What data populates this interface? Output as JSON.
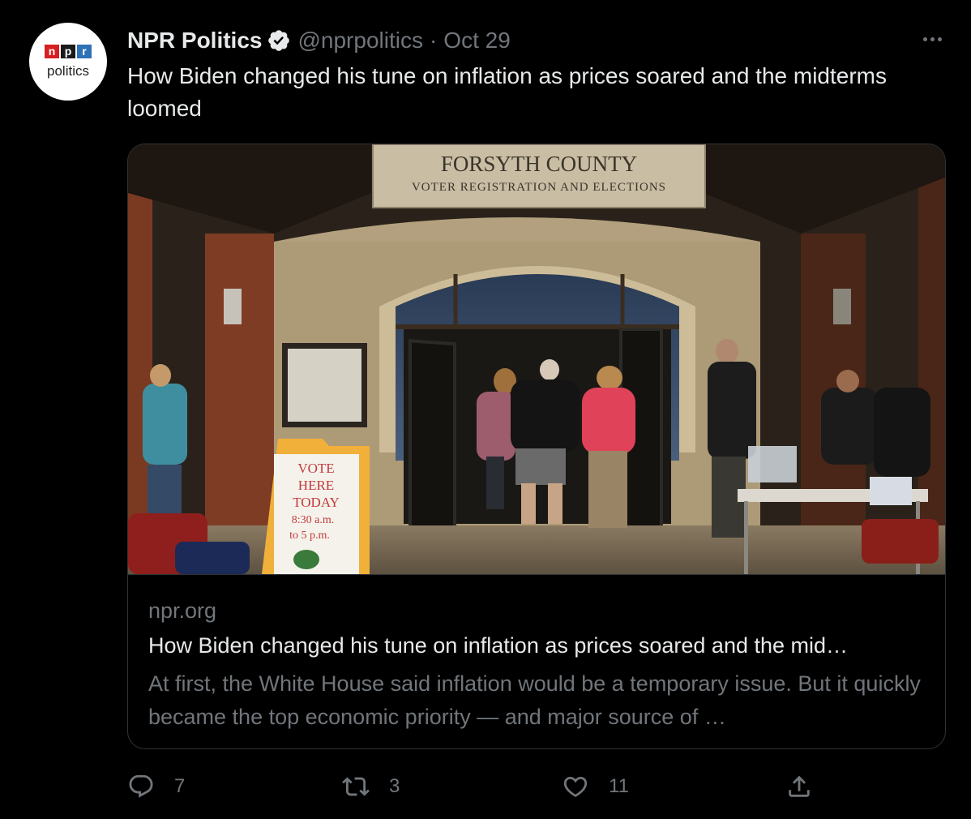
{
  "author": {
    "avatar": {
      "logo_letters": [
        "n",
        "p",
        "r"
      ],
      "subtitle": "politics"
    },
    "name": "NPR Politics",
    "handle": "@nprpolitics",
    "separator": "·",
    "date": "Oct 29",
    "verified_icon": "verified-badge-icon"
  },
  "more_icon": "more-horizontal-icon",
  "tweet": {
    "text": "How Biden changed his tune on inflation as prices soared and the midterms loomed"
  },
  "card": {
    "image": {
      "sign_title": "FORSYTH COUNTY",
      "sign_subtitle": "VOTER REGISTRATION AND ELECTIONS",
      "vote_sign": [
        "VOTE",
        "HERE",
        "TODAY",
        "8:30 a.m.",
        "to 5 p.m."
      ]
    },
    "domain": "npr.org",
    "title": "How Biden changed his tune on inflation as prices soared and the mid…",
    "description": "At first, the White House said inflation would be a temporary issue. But it quickly became the top economic priority — and major source of …"
  },
  "actions": {
    "reply": {
      "icon": "reply-icon",
      "count": "7"
    },
    "retweet": {
      "icon": "retweet-icon",
      "count": "3"
    },
    "like": {
      "icon": "heart-icon",
      "count": "11"
    },
    "share": {
      "icon": "share-icon"
    }
  },
  "colors": {
    "background": "#000000",
    "primary_text": "#e7e9ea",
    "secondary_text": "#71767b",
    "border": "#2f3336"
  }
}
